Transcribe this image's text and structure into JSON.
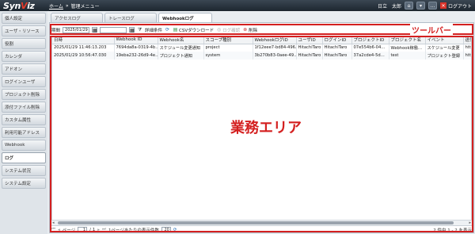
{
  "header": {
    "logo_pre": "Syn",
    "logo_v": "V",
    "logo_post": "iz",
    "crumb_home": "ホーム",
    "crumb_sep": "»",
    "crumb_current": "管理メニュー",
    "user": "日立　太郎",
    "logout": "ログアウト"
  },
  "sidebar": {
    "items": [
      {
        "label": "個人設定"
      },
      {
        "label": "ユーザ・リソース"
      },
      {
        "label": "役割"
      },
      {
        "label": "カレンダ"
      },
      {
        "label": "アドオン"
      },
      {
        "label": "ログインユーザ"
      },
      {
        "label": "プロジェクト削除"
      },
      {
        "label": "添付ファイル削除"
      },
      {
        "label": "カスタム属性"
      },
      {
        "label": "利用可能アドレス"
      },
      {
        "label": "Webhook"
      },
      {
        "label": "ログ"
      },
      {
        "label": "システム状況"
      },
      {
        "label": "システム設定"
      }
    ],
    "active_index": 11
  },
  "tabs": [
    {
      "label": "アクセスログ"
    },
    {
      "label": "トレースログ"
    },
    {
      "label": "Webhookログ"
    }
  ],
  "toolbar": {
    "period_label": "期間",
    "date_value": "2025/01/29",
    "detail_label": "詳細条件",
    "csv_label": "CSVダウンロード",
    "log_confirm_label": "ログ確認",
    "delete_label": "削除"
  },
  "table": {
    "headers": [
      "日時",
      "Webhook ID",
      "Webhook名",
      "スコープ種別",
      "WebhookログID",
      "ユーザID",
      "ログインID",
      "プロジェクトID",
      "プロジェクト名",
      "イベント",
      "送信"
    ],
    "rows": [
      [
        "2025/01/29 11:46:13.203",
        "7694da8a-0319-4b…",
        "スケジュール変更通知",
        "project",
        "1f12eee7-bd84-496…",
        "HitachiTaro",
        "HitachiTaro",
        "07e554b6-04…",
        "Webhook稼働…",
        "スケジュール変更",
        "https"
      ],
      [
        "2025/01/29 10:56:47.030",
        "19eba232-26d9-4e…",
        "プロジェクト通知",
        "system",
        "3b270b83-0aee-49…",
        "HitachiTaro",
        "HitachiTaro",
        "37a2cde4-5d…",
        "test",
        "プロジェクト登録",
        "https"
      ]
    ]
  },
  "pager": {
    "page_label": "ページ",
    "page_value": "1",
    "page_total": "/ 1",
    "per_page_label": "1ページあたりの表示件数",
    "per_page_value": "20",
    "summary": "2 件中 1 - 2 を表示"
  },
  "annotations": {
    "toolbar": "ツールバー",
    "work_area": "業務エリア"
  },
  "colors": {
    "annotation": "#d42020",
    "header_bg": "#1d262f"
  }
}
